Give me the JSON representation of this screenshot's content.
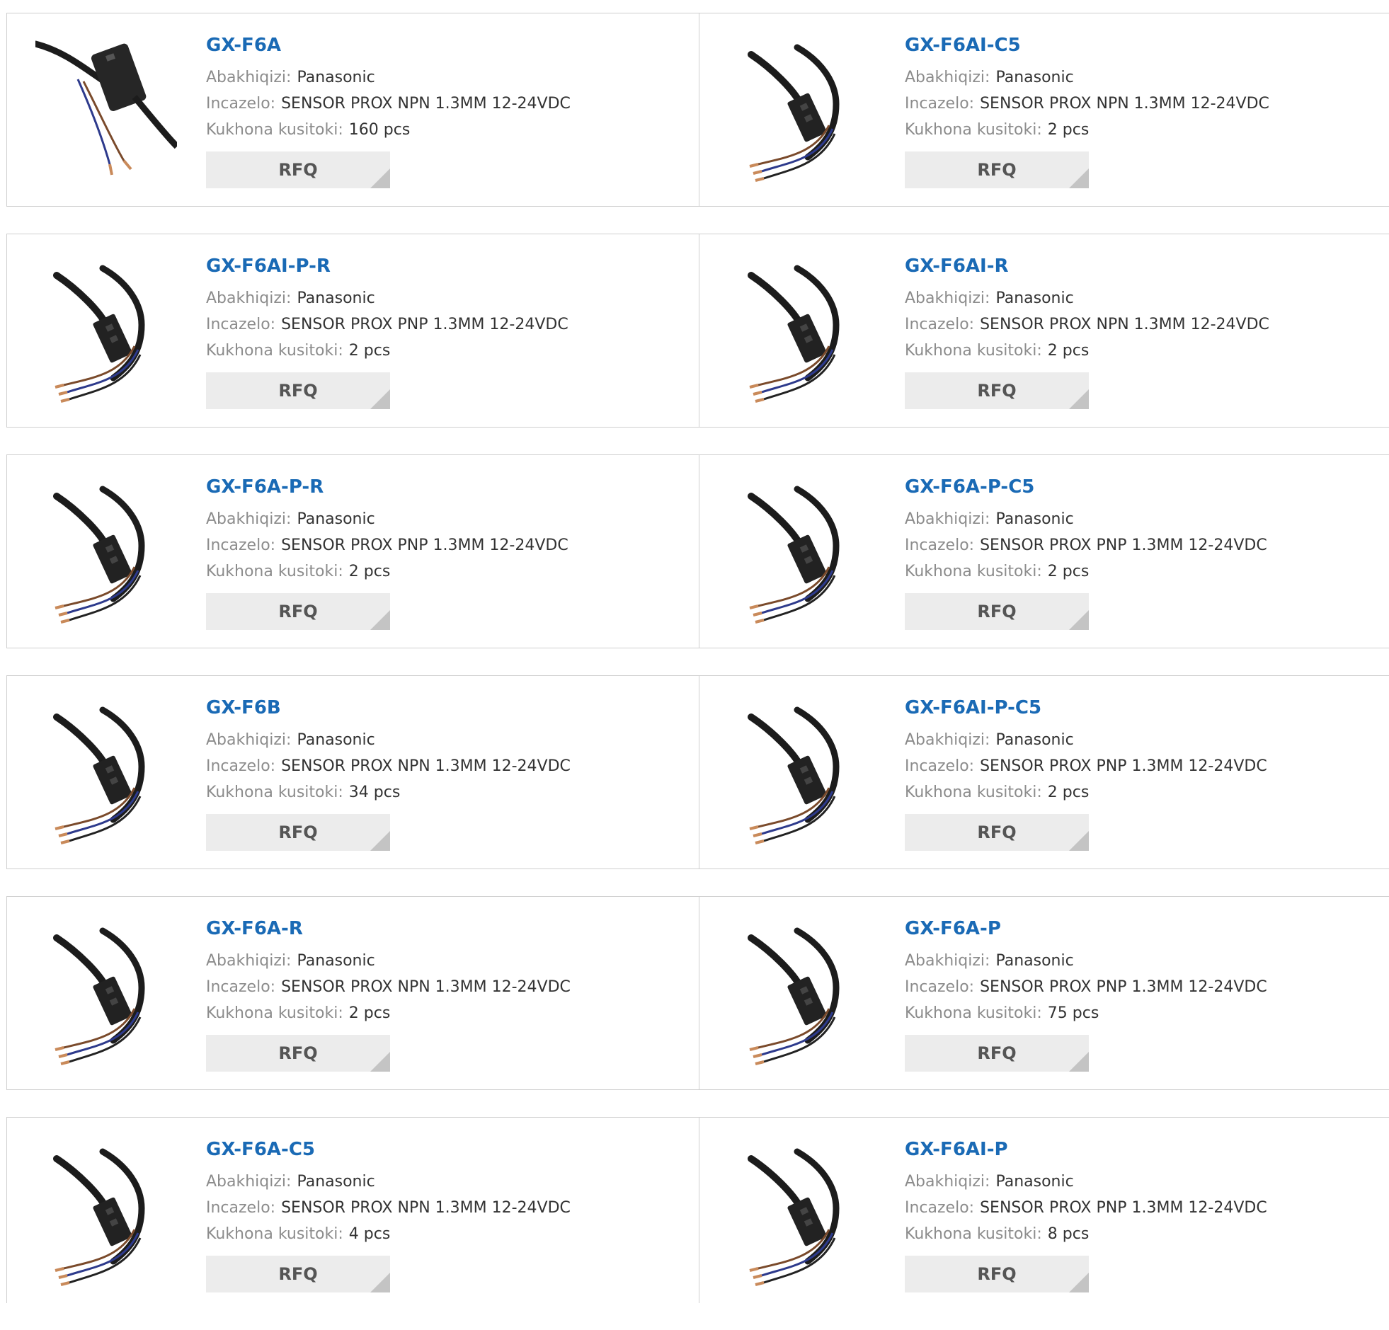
{
  "labels": {
    "manufacturer": "Abakhiqizi:",
    "description": "Incazelo:",
    "stock": "Kukhona kusitoki:",
    "rfq": "RFQ"
  },
  "colors": {
    "link": "#1a6ab5",
    "label": "#8c8c8c",
    "value": "#333333",
    "button": "#ececec"
  },
  "products": [
    {
      "name": "GX-F6A",
      "manufacturer": "Panasonic",
      "description": "SENSOR PROX NPN 1.3MM 12-24VDC",
      "stock": "160 pcs",
      "image_icon": "proximity-sensor-side-view-icon"
    },
    {
      "name": "GX-F6AI-C5",
      "manufacturer": "Panasonic",
      "description": "SENSOR PROX NPN 1.3MM 12-24VDC",
      "stock": "2 pcs",
      "image_icon": "proximity-sensor-icon"
    },
    {
      "name": "GX-F6AI-P-R",
      "manufacturer": "Panasonic",
      "description": "SENSOR PROX PNP 1.3MM 12-24VDC",
      "stock": "2 pcs",
      "image_icon": "proximity-sensor-icon"
    },
    {
      "name": "GX-F6AI-R",
      "manufacturer": "Panasonic",
      "description": "SENSOR PROX NPN 1.3MM 12-24VDC",
      "stock": "2 pcs",
      "image_icon": "proximity-sensor-icon"
    },
    {
      "name": "GX-F6A-P-R",
      "manufacturer": "Panasonic",
      "description": "SENSOR PROX PNP 1.3MM 12-24VDC",
      "stock": "2 pcs",
      "image_icon": "proximity-sensor-icon"
    },
    {
      "name": "GX-F6A-P-C5",
      "manufacturer": "Panasonic",
      "description": "SENSOR PROX PNP 1.3MM 12-24VDC",
      "stock": "2 pcs",
      "image_icon": "proximity-sensor-icon"
    },
    {
      "name": "GX-F6B",
      "manufacturer": "Panasonic",
      "description": "SENSOR PROX NPN 1.3MM 12-24VDC",
      "stock": "34 pcs",
      "image_icon": "proximity-sensor-icon"
    },
    {
      "name": "GX-F6AI-P-C5",
      "manufacturer": "Panasonic",
      "description": "SENSOR PROX PNP 1.3MM 12-24VDC",
      "stock": "2 pcs",
      "image_icon": "proximity-sensor-icon"
    },
    {
      "name": "GX-F6A-R",
      "manufacturer": "Panasonic",
      "description": "SENSOR PROX NPN 1.3MM 12-24VDC",
      "stock": "2 pcs",
      "image_icon": "proximity-sensor-icon"
    },
    {
      "name": "GX-F6A-P",
      "manufacturer": "Panasonic",
      "description": "SENSOR PROX PNP 1.3MM 12-24VDC",
      "stock": "75 pcs",
      "image_icon": "proximity-sensor-icon"
    },
    {
      "name": "GX-F6A-C5",
      "manufacturer": "Panasonic",
      "description": "SENSOR PROX NPN 1.3MM 12-24VDC",
      "stock": "4 pcs",
      "image_icon": "proximity-sensor-icon"
    },
    {
      "name": "GX-F6AI-P",
      "manufacturer": "Panasonic",
      "description": "SENSOR PROX PNP 1.3MM 12-24VDC",
      "stock": "8 pcs",
      "image_icon": "proximity-sensor-icon"
    }
  ]
}
